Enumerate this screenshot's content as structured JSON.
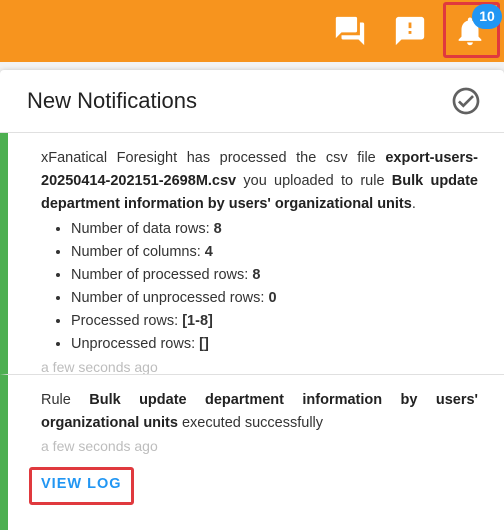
{
  "topbar": {
    "bg_color": "#f7941e",
    "icons": [
      "chat-icon",
      "feedback-icon",
      "bell-icon"
    ],
    "notification_count": "10"
  },
  "panel": {
    "title": "New Notifications",
    "mark_read_icon": "check-circle-icon"
  },
  "notifications": [
    {
      "text_prefix": "xFanatical Foresight has processed the csv file ",
      "file_name": "export-users-20250414-202151-2698M.csv",
      "text_middle": " you uploaded to rule ",
      "rule_name": "Bulk update department information by users' organizational units",
      "text_suffix": ".",
      "stats": [
        {
          "label": "Number of data rows: ",
          "value": "8"
        },
        {
          "label": "Number of columns: ",
          "value": "4"
        },
        {
          "label": "Number of processed rows: ",
          "value": "8"
        },
        {
          "label": "Number of unprocessed rows: ",
          "value": "0"
        },
        {
          "label": "Processed rows: ",
          "value": "[1-8]"
        },
        {
          "label": "Unprocessed rows: ",
          "value": "[]"
        }
      ],
      "time": "a few seconds ago"
    },
    {
      "text_prefix": "Rule ",
      "rule_name": "Bulk update department information by users' organizational units",
      "text_suffix": " executed successfully",
      "time": "a few seconds ago",
      "action_label": "VIEW LOG"
    }
  ],
  "accent_color": "#2196f3",
  "status_color": "#4caf50"
}
